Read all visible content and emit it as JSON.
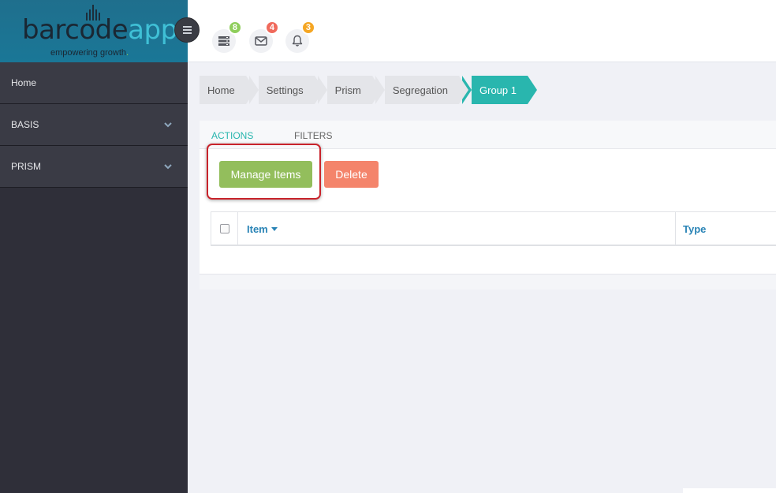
{
  "logo": {
    "word_dark": "barcode",
    "word_light": "apps",
    "tagline": "empowering growth",
    "tagline_dot": ".",
    "colors": {
      "bg": "#1f6f8d",
      "dark": "#1a2733",
      "light": "#3fc0d6"
    }
  },
  "topbar": {
    "menu_icon": "hamburger-icon",
    "icons": [
      {
        "icon": "server-icon",
        "badge": "8",
        "badge_color": "#8fce5c"
      },
      {
        "icon": "envelope-icon",
        "badge": "4",
        "badge_color": "#f06a5c"
      },
      {
        "icon": "bell-icon",
        "badge": "3",
        "badge_color": "#f5a623"
      }
    ]
  },
  "sidebar": {
    "items": [
      {
        "label": "Home",
        "has_chevron": false
      },
      {
        "label": "BASIS",
        "has_chevron": true
      },
      {
        "label": "PRISM",
        "has_chevron": true
      }
    ]
  },
  "breadcrumb": {
    "items": [
      "Home",
      "Settings",
      "Prism",
      "Segregation",
      "Group 1"
    ],
    "active_index": 4,
    "active_color": "#29b6ae"
  },
  "panel": {
    "tabs": [
      {
        "label": "ACTIONS",
        "active": true
      },
      {
        "label": "FILTERS",
        "active": false
      }
    ],
    "buttons": {
      "manage_items": {
        "label": "Manage Items",
        "color": "#93be5c"
      },
      "delete": {
        "label": "Delete",
        "color": "#f4846b"
      }
    },
    "table": {
      "columns": [
        {
          "label": "Item",
          "sorted": true
        },
        {
          "label": "Type",
          "sorted": false
        }
      ],
      "header_color": "#2a84b6"
    }
  }
}
